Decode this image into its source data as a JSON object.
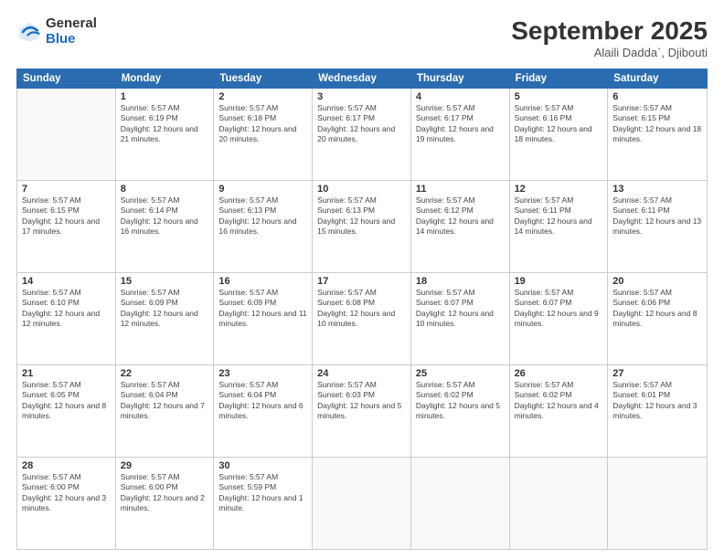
{
  "header": {
    "logo": {
      "general": "General",
      "blue": "Blue"
    },
    "title": "September 2025",
    "subtitle": "Alaili Dadda`, Djibouti"
  },
  "calendar": {
    "days_of_week": [
      "Sunday",
      "Monday",
      "Tuesday",
      "Wednesday",
      "Thursday",
      "Friday",
      "Saturday"
    ],
    "weeks": [
      [
        {
          "day": "",
          "sunrise": "",
          "sunset": "",
          "daylight": ""
        },
        {
          "day": "1",
          "sunrise": "Sunrise: 5:57 AM",
          "sunset": "Sunset: 6:19 PM",
          "daylight": "Daylight: 12 hours and 21 minutes."
        },
        {
          "day": "2",
          "sunrise": "Sunrise: 5:57 AM",
          "sunset": "Sunset: 6:18 PM",
          "daylight": "Daylight: 12 hours and 20 minutes."
        },
        {
          "day": "3",
          "sunrise": "Sunrise: 5:57 AM",
          "sunset": "Sunset: 6:17 PM",
          "daylight": "Daylight: 12 hours and 20 minutes."
        },
        {
          "day": "4",
          "sunrise": "Sunrise: 5:57 AM",
          "sunset": "Sunset: 6:17 PM",
          "daylight": "Daylight: 12 hours and 19 minutes."
        },
        {
          "day": "5",
          "sunrise": "Sunrise: 5:57 AM",
          "sunset": "Sunset: 6:16 PM",
          "daylight": "Daylight: 12 hours and 18 minutes."
        },
        {
          "day": "6",
          "sunrise": "Sunrise: 5:57 AM",
          "sunset": "Sunset: 6:15 PM",
          "daylight": "Daylight: 12 hours and 18 minutes."
        }
      ],
      [
        {
          "day": "7",
          "sunrise": "Sunrise: 5:57 AM",
          "sunset": "Sunset: 6:15 PM",
          "daylight": "Daylight: 12 hours and 17 minutes."
        },
        {
          "day": "8",
          "sunrise": "Sunrise: 5:57 AM",
          "sunset": "Sunset: 6:14 PM",
          "daylight": "Daylight: 12 hours and 16 minutes."
        },
        {
          "day": "9",
          "sunrise": "Sunrise: 5:57 AM",
          "sunset": "Sunset: 6:13 PM",
          "daylight": "Daylight: 12 hours and 16 minutes."
        },
        {
          "day": "10",
          "sunrise": "Sunrise: 5:57 AM",
          "sunset": "Sunset: 6:13 PM",
          "daylight": "Daylight: 12 hours and 15 minutes."
        },
        {
          "day": "11",
          "sunrise": "Sunrise: 5:57 AM",
          "sunset": "Sunset: 6:12 PM",
          "daylight": "Daylight: 12 hours and 14 minutes."
        },
        {
          "day": "12",
          "sunrise": "Sunrise: 5:57 AM",
          "sunset": "Sunset: 6:11 PM",
          "daylight": "Daylight: 12 hours and 14 minutes."
        },
        {
          "day": "13",
          "sunrise": "Sunrise: 5:57 AM",
          "sunset": "Sunset: 6:11 PM",
          "daylight": "Daylight: 12 hours and 13 minutes."
        }
      ],
      [
        {
          "day": "14",
          "sunrise": "Sunrise: 5:57 AM",
          "sunset": "Sunset: 6:10 PM",
          "daylight": "Daylight: 12 hours and 12 minutes."
        },
        {
          "day": "15",
          "sunrise": "Sunrise: 5:57 AM",
          "sunset": "Sunset: 6:09 PM",
          "daylight": "Daylight: 12 hours and 12 minutes."
        },
        {
          "day": "16",
          "sunrise": "Sunrise: 5:57 AM",
          "sunset": "Sunset: 6:09 PM",
          "daylight": "Daylight: 12 hours and 11 minutes."
        },
        {
          "day": "17",
          "sunrise": "Sunrise: 5:57 AM",
          "sunset": "Sunset: 6:08 PM",
          "daylight": "Daylight: 12 hours and 10 minutes."
        },
        {
          "day": "18",
          "sunrise": "Sunrise: 5:57 AM",
          "sunset": "Sunset: 6:07 PM",
          "daylight": "Daylight: 12 hours and 10 minutes."
        },
        {
          "day": "19",
          "sunrise": "Sunrise: 5:57 AM",
          "sunset": "Sunset: 6:07 PM",
          "daylight": "Daylight: 12 hours and 9 minutes."
        },
        {
          "day": "20",
          "sunrise": "Sunrise: 5:57 AM",
          "sunset": "Sunset: 6:06 PM",
          "daylight": "Daylight: 12 hours and 8 minutes."
        }
      ],
      [
        {
          "day": "21",
          "sunrise": "Sunrise: 5:57 AM",
          "sunset": "Sunset: 6:05 PM",
          "daylight": "Daylight: 12 hours and 8 minutes."
        },
        {
          "day": "22",
          "sunrise": "Sunrise: 5:57 AM",
          "sunset": "Sunset: 6:04 PM",
          "daylight": "Daylight: 12 hours and 7 minutes."
        },
        {
          "day": "23",
          "sunrise": "Sunrise: 5:57 AM",
          "sunset": "Sunset: 6:04 PM",
          "daylight": "Daylight: 12 hours and 6 minutes."
        },
        {
          "day": "24",
          "sunrise": "Sunrise: 5:57 AM",
          "sunset": "Sunset: 6:03 PM",
          "daylight": "Daylight: 12 hours and 5 minutes."
        },
        {
          "day": "25",
          "sunrise": "Sunrise: 5:57 AM",
          "sunset": "Sunset: 6:02 PM",
          "daylight": "Daylight: 12 hours and 5 minutes."
        },
        {
          "day": "26",
          "sunrise": "Sunrise: 5:57 AM",
          "sunset": "Sunset: 6:02 PM",
          "daylight": "Daylight: 12 hours and 4 minutes."
        },
        {
          "day": "27",
          "sunrise": "Sunrise: 5:57 AM",
          "sunset": "Sunset: 6:01 PM",
          "daylight": "Daylight: 12 hours and 3 minutes."
        }
      ],
      [
        {
          "day": "28",
          "sunrise": "Sunrise: 5:57 AM",
          "sunset": "Sunset: 6:00 PM",
          "daylight": "Daylight: 12 hours and 3 minutes."
        },
        {
          "day": "29",
          "sunrise": "Sunrise: 5:57 AM",
          "sunset": "Sunset: 6:00 PM",
          "daylight": "Daylight: 12 hours and 2 minutes."
        },
        {
          "day": "30",
          "sunrise": "Sunrise: 5:57 AM",
          "sunset": "Sunset: 5:59 PM",
          "daylight": "Daylight: 12 hours and 1 minute."
        },
        {
          "day": "",
          "sunrise": "",
          "sunset": "",
          "daylight": ""
        },
        {
          "day": "",
          "sunrise": "",
          "sunset": "",
          "daylight": ""
        },
        {
          "day": "",
          "sunrise": "",
          "sunset": "",
          "daylight": ""
        },
        {
          "day": "",
          "sunrise": "",
          "sunset": "",
          "daylight": ""
        }
      ]
    ]
  }
}
